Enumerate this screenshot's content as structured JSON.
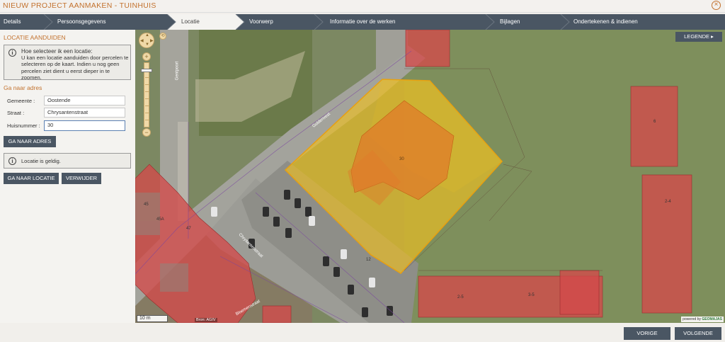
{
  "window": {
    "title": "NIEUW PROJECT AANMAKEN - TUINHUIS"
  },
  "steps": [
    {
      "label": "Details"
    },
    {
      "label": "Persoonsgegevens"
    },
    {
      "label": "Locatie"
    },
    {
      "label": "Voorwerp"
    },
    {
      "label": "Informatie over de werken"
    },
    {
      "label": "Bijlagen"
    },
    {
      "label": "Ondertekenen & indienen"
    }
  ],
  "sidebar": {
    "section_title": "LOCATIE AANDUIDEN",
    "info": {
      "heading": "Hoe selecteer ik een locatie:",
      "body": "U kan een locatie aanduiden door percelen te selecteren op de kaart. Indien u nog geen percelen ziet dient u eerst dieper in te zoomen."
    },
    "address_title": "Ga naar adres",
    "fields": {
      "gemeente_label": "Gemeente :",
      "gemeente_value": "Oostende",
      "straat_label": "Straat :",
      "straat_value": "Chrysantenstraat",
      "huisnummer_label": "Huisnummer :",
      "huisnummer_value": "30"
    },
    "goto_address_button": "GA NAAR ADRES",
    "status": "Locatie is geldig.",
    "goto_location_button": "GA NAAR LOCATIE",
    "remove_button": "VERWIJDER"
  },
  "map": {
    "legend_button": "LEGENDE",
    "scale": "10 m",
    "source": "Bron: AGIV",
    "powered_by": "powered by",
    "powered_brand": "GEOMAJAS",
    "street_labels": {
      "a": "Gentpoort",
      "b": "Guldenvest",
      "c": "Chrysantenstraat",
      "d": "Bloemenstraat"
    },
    "house_numbers": {
      "n30": "30",
      "n45": "45",
      "n45a": "45A",
      "n47": "47",
      "n2_5": "2-5",
      "n3_5": "3-5",
      "n2_4": "2-4",
      "n12": "12",
      "n6": "6"
    },
    "colors": {
      "selection_fill": "#f0c020",
      "selection_stroke": "#e8a010",
      "building_fill": "#d44a4a",
      "road": "#9c9c96"
    }
  },
  "footer": {
    "previous_button": "VORIGE",
    "next_button": "VOLGENDE"
  },
  "theme": {
    "accent": "#c3722e",
    "primary": "#4a5663"
  }
}
